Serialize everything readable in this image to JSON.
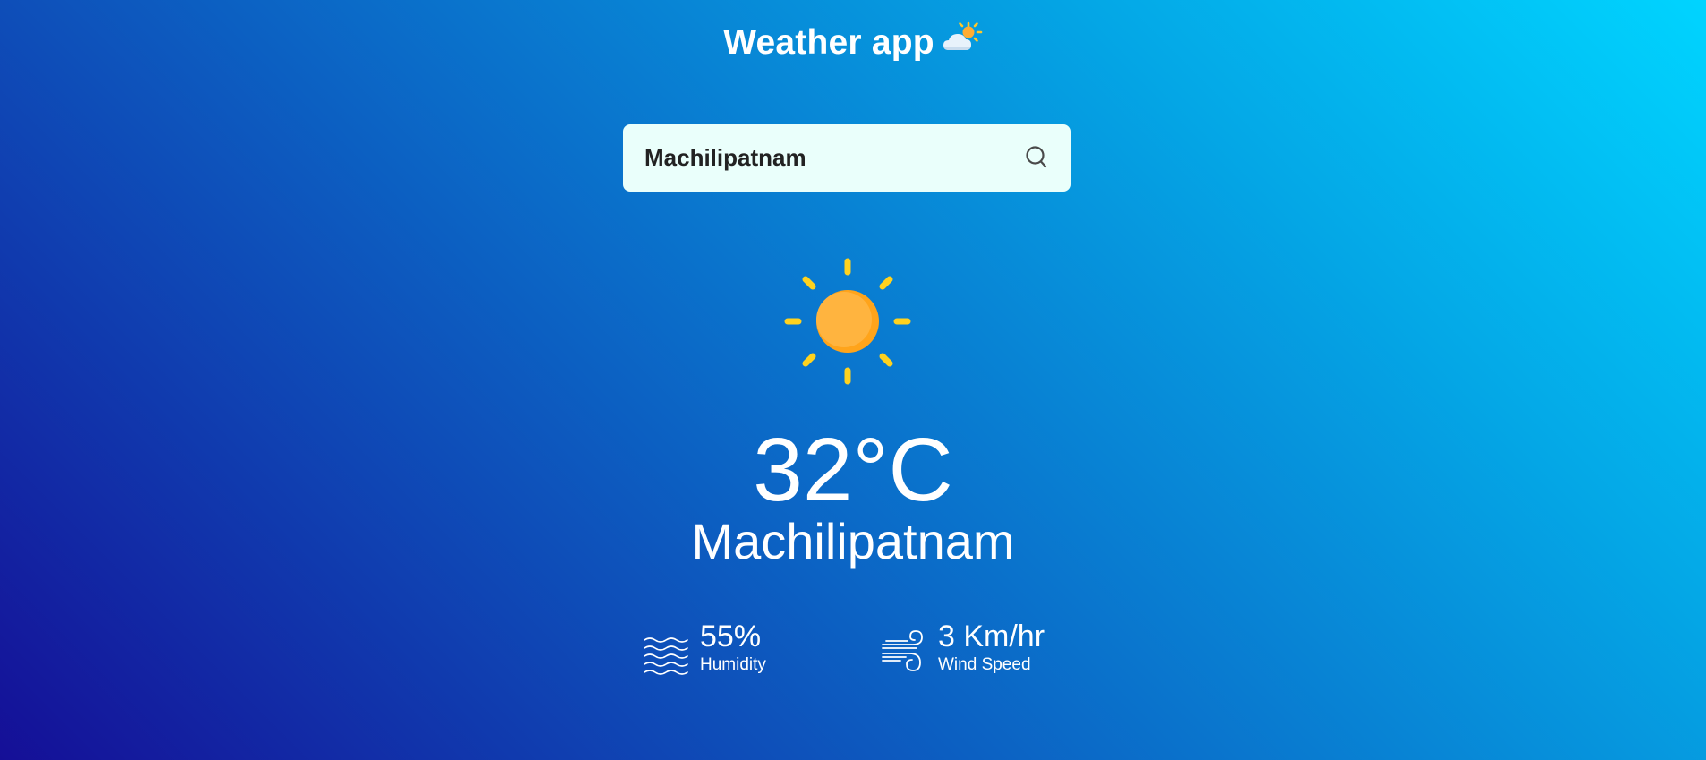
{
  "header": {
    "title": "Weather app",
    "title_icon": "partly-cloudy-icon"
  },
  "search": {
    "value": "Machilipatnam",
    "icon": "search-icon"
  },
  "current": {
    "icon": "sun-icon",
    "temperature": "32°C",
    "city": "Machilipatnam"
  },
  "details": {
    "humidity": {
      "icon": "humidity-waves-icon",
      "value": "55%",
      "label": "Humidity"
    },
    "wind": {
      "icon": "wind-icon",
      "value": "3 Km/hr",
      "label": "Wind Speed"
    }
  },
  "colors": {
    "gradient_start": "#150f97",
    "gradient_end": "#00d4ff",
    "search_bg": "#eafffb",
    "sun_core": "#ffad33",
    "sun_rays": "#ffd21f"
  }
}
